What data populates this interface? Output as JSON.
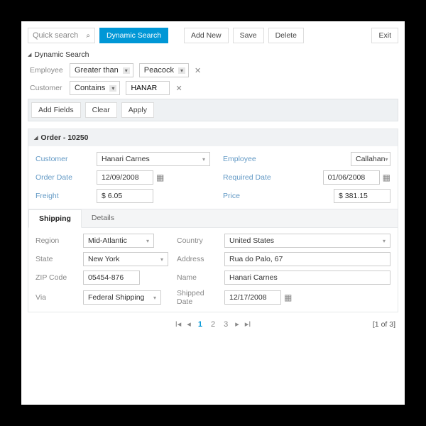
{
  "toolbar": {
    "quick_placeholder": "Quick search",
    "dynamic": "Dynamic Search",
    "add_new": "Add New",
    "save": "Save",
    "delete": "Delete",
    "exit": "Exit"
  },
  "dsearch": {
    "title": "Dynamic Search",
    "rows": [
      {
        "label": "Employee",
        "op": "Greater than",
        "val": "Peacock"
      },
      {
        "label": "Customer",
        "op": "Contains",
        "val": "HANAR"
      }
    ],
    "add_fields": "Add Fields",
    "clear": "Clear",
    "apply": "Apply"
  },
  "order": {
    "header": "Order - 10250",
    "customer_l": "Customer",
    "customer": "Hanari Carnes",
    "employee_l": "Employee",
    "employee": "Callahan",
    "order_date_l": "Order Date",
    "order_date": "12/09/2008",
    "required_date_l": "Required Date",
    "required_date": "01/06/2008",
    "freight_l": "Freight",
    "freight": "$ 6.05",
    "price_l": "Price",
    "price": "$ 381.15"
  },
  "tabs": {
    "shipping": "Shipping",
    "details": "Details"
  },
  "shipping": {
    "region_l": "Region",
    "region": "Mid-Atlantic",
    "country_l": "Country",
    "country": "United States",
    "state_l": "State",
    "state": "New York",
    "address_l": "Address",
    "address": "Rua do Palo, 67",
    "zip_l": "ZIP Code",
    "zip": "05454-876",
    "name_l": "Name",
    "name": "Hanari Carnes",
    "via_l": "Via",
    "via": "Federal Shipping",
    "shipped_l": "Shipped Date",
    "shipped": "12/17/2008"
  },
  "pager": {
    "p1": "1",
    "p2": "2",
    "p3": "3",
    "status": "[1 of 3]"
  }
}
